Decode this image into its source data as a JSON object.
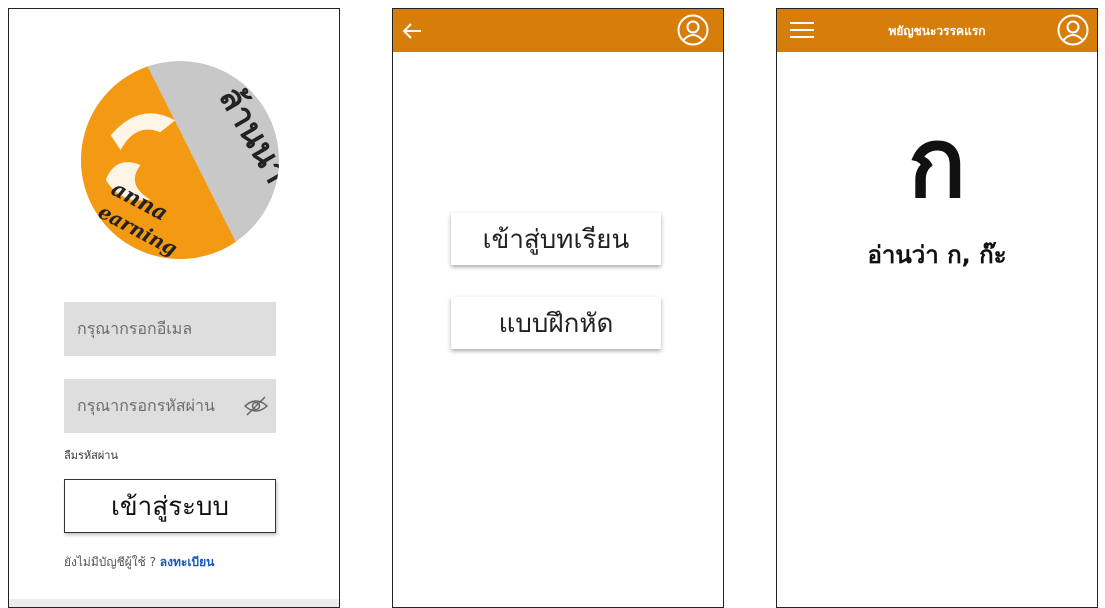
{
  "login_screen": {
    "logo": {
      "thai_text": "ล้านนา",
      "latin_text": "Lanna Learning",
      "colors": {
        "orange": "#f39a12",
        "grey": "#c8c8c8",
        "ink": "#222222"
      }
    },
    "email_placeholder": "กรุณากรอกอีเมล",
    "password_placeholder": "กรุณากรอกรหัสผ่าน",
    "password_toggle_icon": "eye-slash-icon",
    "forgot_password": "ลืมรหัสผ่าน",
    "login_button": "เข้าสู่ระบบ",
    "no_account_text": "ยังไม่มีบัญชีผู้ใช้ ?",
    "register_link": "ลงทะเบียน"
  },
  "menu_screen": {
    "header": {
      "back_icon": "arrow-left-icon",
      "profile_icon": "user-circle-icon"
    },
    "lesson_button": "เข้าสู่บทเรียน",
    "exercise_button": "แบบฝึกหัด"
  },
  "letter_screen": {
    "header": {
      "menu_icon": "hamburger-menu-icon",
      "title": "พยัญชนะวรรคแรก",
      "profile_icon": "user-circle-icon"
    },
    "letter": "ก",
    "reading": "อ่านว่า ก, ก๊ะ"
  },
  "colors": {
    "header_bg": "#d67d0a",
    "link": "#1a5ab5",
    "field_bg": "#dedede"
  }
}
